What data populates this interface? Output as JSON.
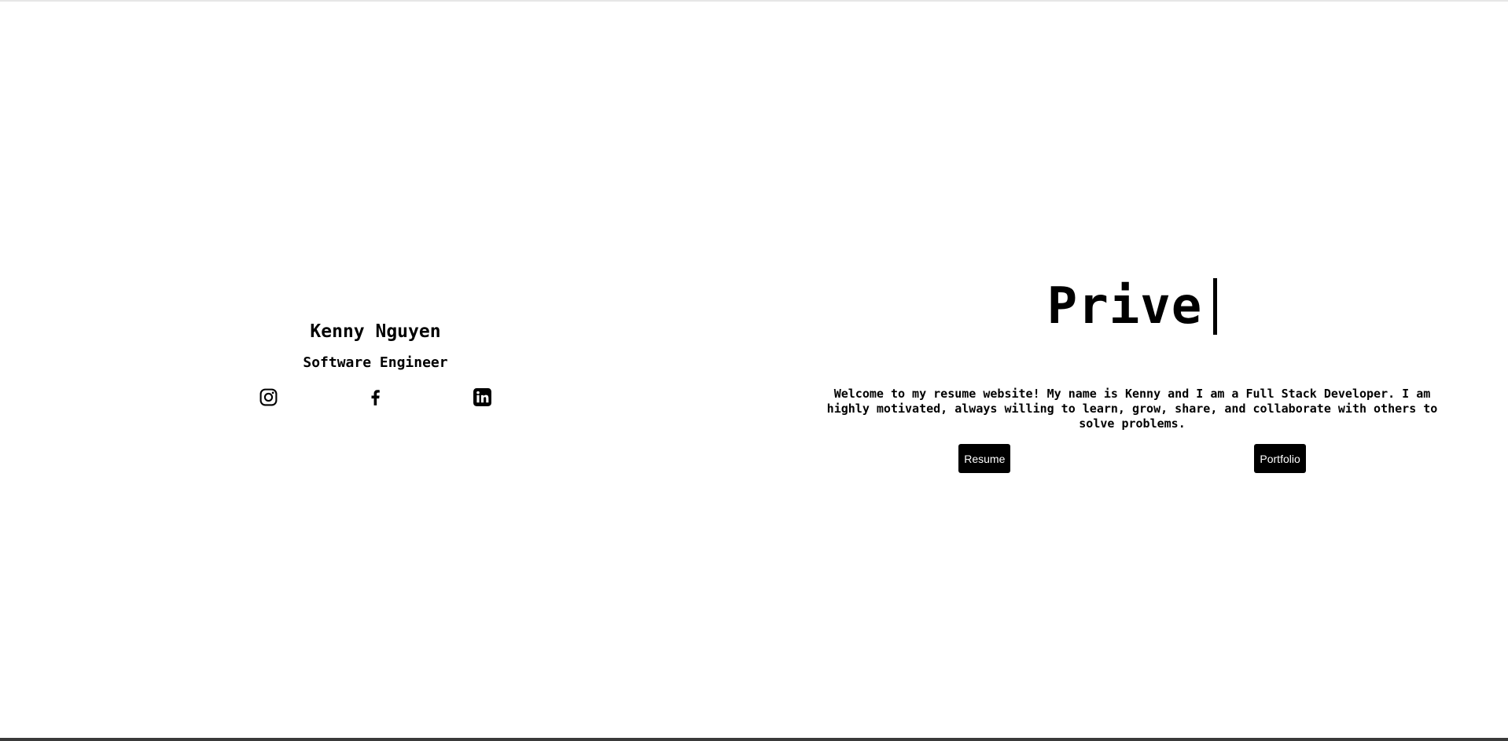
{
  "profile": {
    "name": "Kenny Nguyen",
    "title": "Software Engineer",
    "social": [
      {
        "icon": "instagram-icon"
      },
      {
        "icon": "facebook-icon"
      },
      {
        "icon": "linkedin-icon"
      }
    ]
  },
  "hero": {
    "typed_text": "Prive",
    "welcome": "Welcome to my resume website! My name is Kenny and I am a Full Stack Developer. I am highly motivated, always willing to learn, grow, share, and collaborate with others to solve problems.",
    "buttons": {
      "resume_label": "Resume",
      "portfolio_label": "Portfolio"
    }
  },
  "colors": {
    "background": "#ffffff",
    "text": "#000000",
    "button_bg": "#000000",
    "button_text": "#ffffff"
  }
}
